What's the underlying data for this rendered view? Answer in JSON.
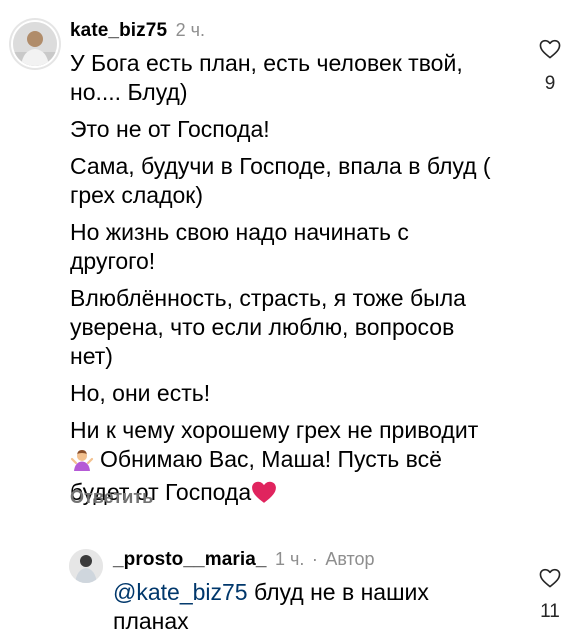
{
  "comment": {
    "username": "kate_biz75",
    "time": "2 ч.",
    "paragraphs": [
      [
        "У Бога есть план, есть человек твой,",
        "но.... Блуд)"
      ],
      [
        "Это не от Господа!"
      ],
      [
        "Сама, будучи в Господе, впала в блуд (",
        "грех сладок)"
      ],
      [
        "Но жизнь свою надо начинать с",
        "другого!"
      ],
      [
        "Влюблённость, страсть, я тоже была",
        "уверена, что если люблю, вопросов",
        "нет)"
      ],
      [
        "Но, они есть!"
      ],
      [
        "Ни к чему хорошему грех не приводит"
      ]
    ],
    "line_with_emoji_a": "Обнимаю Вас, Маша! Пусть всё",
    "line_with_emoji_b": "будет от Господа",
    "emoji_a": "person-shrugging-emoji",
    "emoji_b": "red-heart-emoji",
    "like_count": "9",
    "reply_label": "Ответить"
  },
  "reply": {
    "username": "_prosto__maria_",
    "time": "1 ч.",
    "separator": "·",
    "author_badge": "Автор",
    "mention": "@kate_biz75",
    "text_a": " блуд не в наших",
    "text_b": "планах",
    "like_count": "11"
  },
  "colors": {
    "text": "#000000",
    "meta": "#8e8e8e",
    "mention": "#00376b",
    "heart_emoji": "#e0245e"
  }
}
